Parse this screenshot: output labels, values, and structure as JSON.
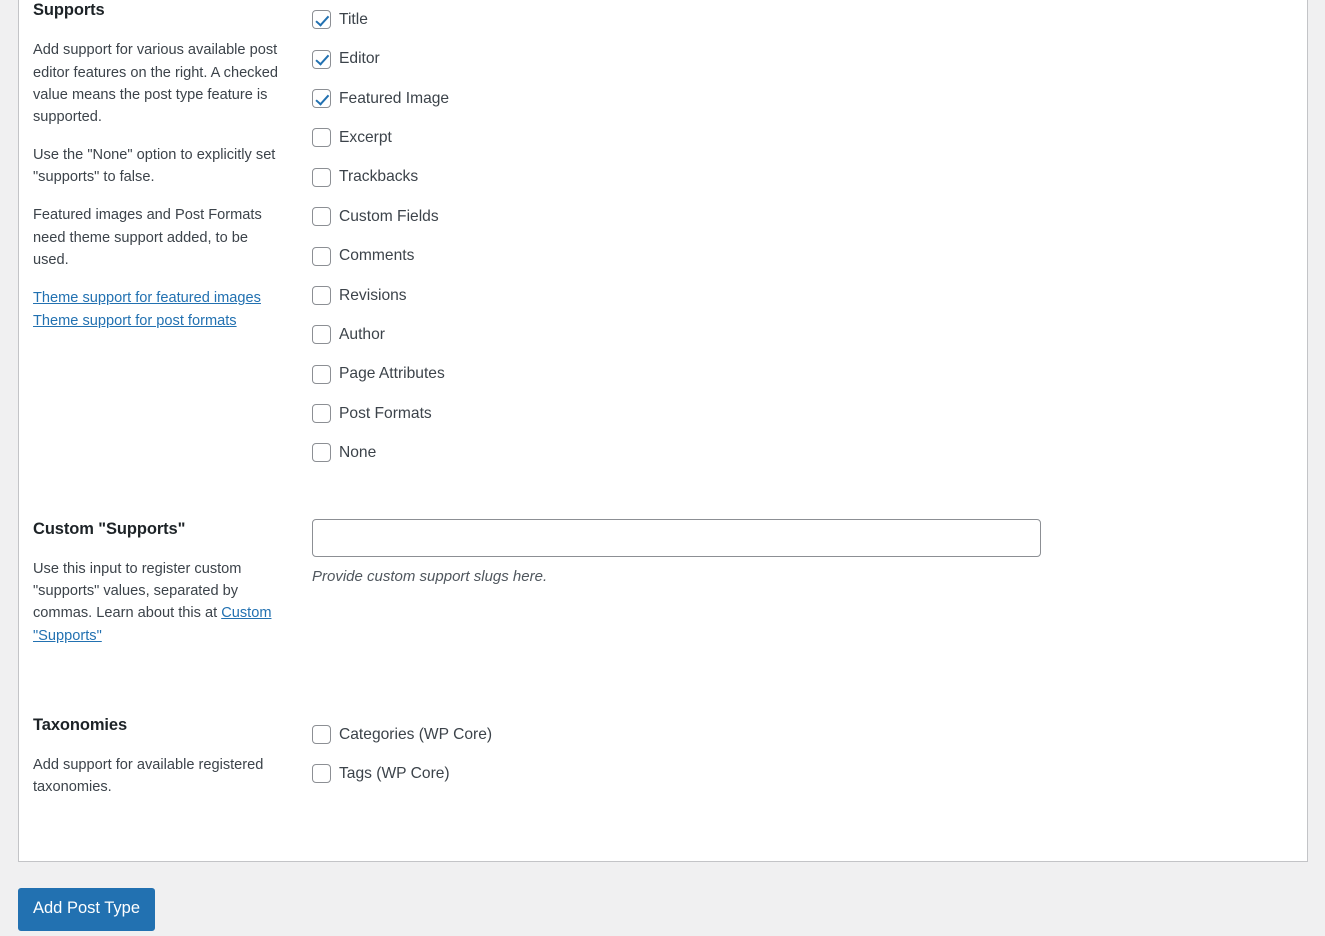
{
  "page": {
    "background_color": "#f0f0f1",
    "panel_color": "#ffffff",
    "accent_color": "#2271b1",
    "link_color": "#2271b1"
  },
  "supports_section": {
    "title": "Supports",
    "descriptions": [
      "Add support for various available post editor features on the right. A checked value means the post type feature is supported.",
      "Use the \"None\" option to explicitly set \"supports\" to false.",
      "Featured images and Post Formats need theme support added, to be used."
    ],
    "links": [
      {
        "label": "Theme support for featured images"
      },
      {
        "label": "Theme support for post formats"
      }
    ],
    "options": [
      {
        "label": "Title",
        "checked": true
      },
      {
        "label": "Editor",
        "checked": true
      },
      {
        "label": "Featured Image",
        "checked": true
      },
      {
        "label": "Excerpt",
        "checked": false
      },
      {
        "label": "Trackbacks",
        "checked": false
      },
      {
        "label": "Custom Fields",
        "checked": false
      },
      {
        "label": "Comments",
        "checked": false
      },
      {
        "label": "Revisions",
        "checked": false
      },
      {
        "label": "Author",
        "checked": false
      },
      {
        "label": "Page Attributes",
        "checked": false
      },
      {
        "label": "Post Formats",
        "checked": false
      },
      {
        "label": "None",
        "checked": false
      }
    ]
  },
  "custom_supports_section": {
    "title": "Custom \"Supports\"",
    "description_before_link": "Use this input to register custom \"supports\" values, separated by commas. Learn about this at ",
    "description_link": "Custom \"Supports\"",
    "input": {
      "value": "",
      "placeholder": ""
    },
    "help_text": "Provide custom support slugs here."
  },
  "taxonomies_section": {
    "title": "Taxonomies",
    "description": "Add support for available registered taxonomies.",
    "options": [
      {
        "label": "Categories (WP Core)",
        "checked": false
      },
      {
        "label": "Tags (WP Core)",
        "checked": false
      }
    ]
  },
  "footer": {
    "submit_label": "Add Post Type"
  }
}
